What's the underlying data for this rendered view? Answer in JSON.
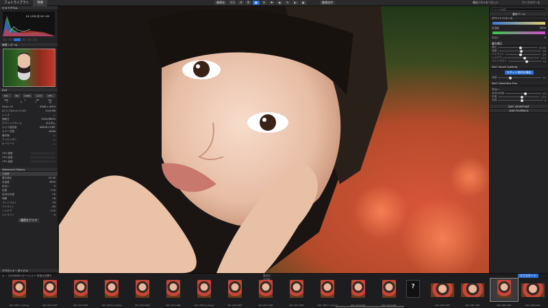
{
  "tabs": [
    "フォトライブラリ",
    "現像"
  ],
  "toolbar": {
    "items": [
      "最適化",
      "1:1",
      "A",
      "B"
    ],
    "right_button": "最適化中",
    "right_links": [
      "構成パネルをリセット",
      "ワークスペース"
    ]
  },
  "left": {
    "histogram_title": "ヒストグラム",
    "histogram_info": "f/4 1/250 秒 ISO 100",
    "navigator_title": "参照 / ズーム",
    "exif_title": "Exif",
    "exif_buttons": [
      "ISO 100",
      "f/4",
      "1/250 s",
      "+0.3 EV",
      "135 mm"
    ],
    "exif_rows": [
      {
        "k": "Nikon Z6",
        "v": "6048 x 4024"
      },
      {
        "k": "AF-S 135mm f/1.8G",
        "v": "24.6 MB"
      },
      {
        "k": "レンズ",
        "v": "—"
      },
      {
        "k": "撮影日",
        "v": "2023/06/05"
      },
      {
        "k": "ホワイトバランス",
        "v": "カスタム"
      },
      {
        "k": "カメラ製造者",
        "v": "NIKON CORP."
      },
      {
        "k": "カラー空間",
        "v": "sRGB"
      },
      {
        "k": "著作権",
        "v": "—"
      },
      {
        "k": "クリエイター",
        "v": "—"
      },
      {
        "k": "キーワード",
        "v": "—"
      }
    ],
    "gps_rows": [
      "GPS 緯度",
      "GPS 経度",
      "GPS 高度"
    ],
    "history_title": "Advanced History",
    "history_items": [
      {
        "k": "元画像",
        "v": ""
      },
      {
        "k": "露光補正",
        "v": "+0.30"
      },
      {
        "k": "色温度",
        "v": "5500"
      },
      {
        "k": "色合い",
        "v": "0"
      },
      {
        "k": "彩度",
        "v": "+10"
      },
      {
        "k": "自然な彩度",
        "v": "+5"
      },
      {
        "k": "明瞭",
        "v": "+8"
      },
      {
        "k": "コントラスト",
        "v": "+4"
      },
      {
        "k": "ハイライト",
        "v": "-20"
      },
      {
        "k": "シャドウ",
        "v": "+12"
      },
      {
        "k": "ハイライト",
        "v": "-5"
      }
    ],
    "history_button": "履歴をクリア",
    "bottom_title": "アクセント・ダイアル"
  },
  "right": {
    "search_placeholder": "ツールを検索",
    "section1_title": "基本ツール",
    "wb_title": "ホワイトバランス",
    "wb_rows": [
      {
        "k": "色温度",
        "v": "5500"
      },
      {
        "k": "色合い",
        "v": "0"
      }
    ],
    "exposure_title": "露光補正",
    "exposure_rows": [
      {
        "k": "補正",
        "v": "+0.30"
      },
      {
        "k": "強度",
        "v": "50"
      },
      {
        "k": "ハイライト",
        "v": "-20"
      },
      {
        "k": "シャドウ",
        "v": "+12"
      },
      {
        "k": "コントラスト",
        "v": "+4"
      }
    ],
    "smart_title": "DxO Smart Lighting",
    "smart_button": "スポット測光を検出",
    "smart_rows": [
      {
        "k": "強度",
        "v": "25"
      }
    ],
    "clearview_title": "DxO ClearView Plus",
    "color_title": "カラー",
    "color_rows": [
      {
        "k": "自然な彩度",
        "v": "+5"
      },
      {
        "k": "彩度",
        "v": "+10"
      },
      {
        "k": "色相",
        "v": "0"
      }
    ],
    "viewpoint_title": "DXO VIEWPOINT",
    "filmpack_title": "DXO FILMPACK"
  },
  "strip": {
    "folder": "20230605 ポートレイト 町田＆光周り",
    "center": "表示中",
    "count": "1/140",
    "export_button": "エクスポート",
    "thumbs": [
      "Z6F_0857-4_08.jpg",
      "Z6F_0870.NEF",
      "Z6F_0876.NEF",
      "Z6F_0857-6_08.jpg",
      "Z6F_0873.NEF",
      "Z6F_0874.NEF",
      "Z6F_0857-4_08.jpg",
      "Z6F_0876.NEF",
      "Z6F_0875.NEF",
      "Z6F_0877.NEF",
      "Z6F_0857-4_08.jpg",
      "Z6F_0878.NEF",
      "Z6F_0879.NEF",
      "?",
      "Z6F_0880.NEF",
      "Z6F_0881.NEF",
      "Z6F_0882.NEF",
      "Z6F_0883.NEF"
    ]
  }
}
